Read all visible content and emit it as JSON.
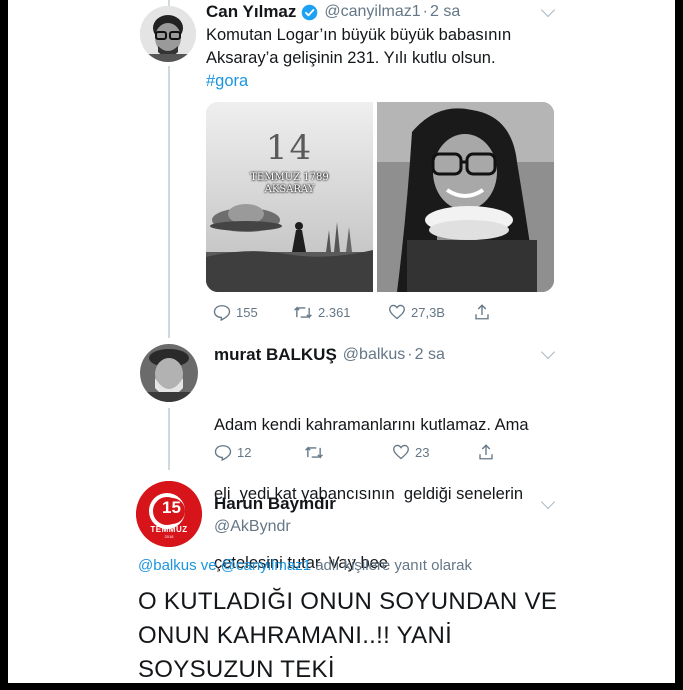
{
  "tweet1": {
    "name": "Can Yılmaz",
    "handle": "@canyilmaz1",
    "dot": "·",
    "time": "2 sa",
    "text_line1": "Komutan Logar’ın büyük büyük babasının",
    "text_line2": "Aksaray’a gelişinin 231. Yılı kutlu olsun.",
    "hashtag": "#gora",
    "image_left": {
      "big_number": "14",
      "caption_line1": "TEMMUZ 1789",
      "caption_line2": "AKSARAY"
    },
    "replies": "155",
    "retweets": "2.361",
    "likes": "27,3B"
  },
  "tweet2": {
    "name": "murat BALKUŞ",
    "handle": "@balkus",
    "dot": "·",
    "time": "2 sa",
    "text_line1": "Adam kendi kahramanlarını kutlamaz. Ama",
    "text_line2": "eli  yedi kat yabancısının  geldiği senelerin",
    "text_line3": "çetelesini tutar. Vay bee",
    "replies": "12",
    "retweets": "",
    "likes": "23"
  },
  "tweet3": {
    "name": "Harun Bayındır",
    "handle": "@AkByndr",
    "avatar_badge_number": "15",
    "avatar_badge_text": "TEMMUZ",
    "avatar_badge_year": "2016",
    "reply_user1": "@balkus",
    "reply_and": "ve",
    "reply_user2": "@canyilmaz1",
    "reply_suffix": "adlı kişilere yanıt olarak",
    "text_line1": "O KUTLADIĞI ONUN SOYUNDAN VE",
    "text_line2": "ONUN KAHRAMANI..!! YANİ",
    "text_line3": "SOYSUZUN TEKİ"
  },
  "colors": {
    "link_blue": "#1b95e0",
    "verified_blue": "#1da1f2",
    "gray_text": "#657786",
    "badge_red": "#d7141a"
  }
}
